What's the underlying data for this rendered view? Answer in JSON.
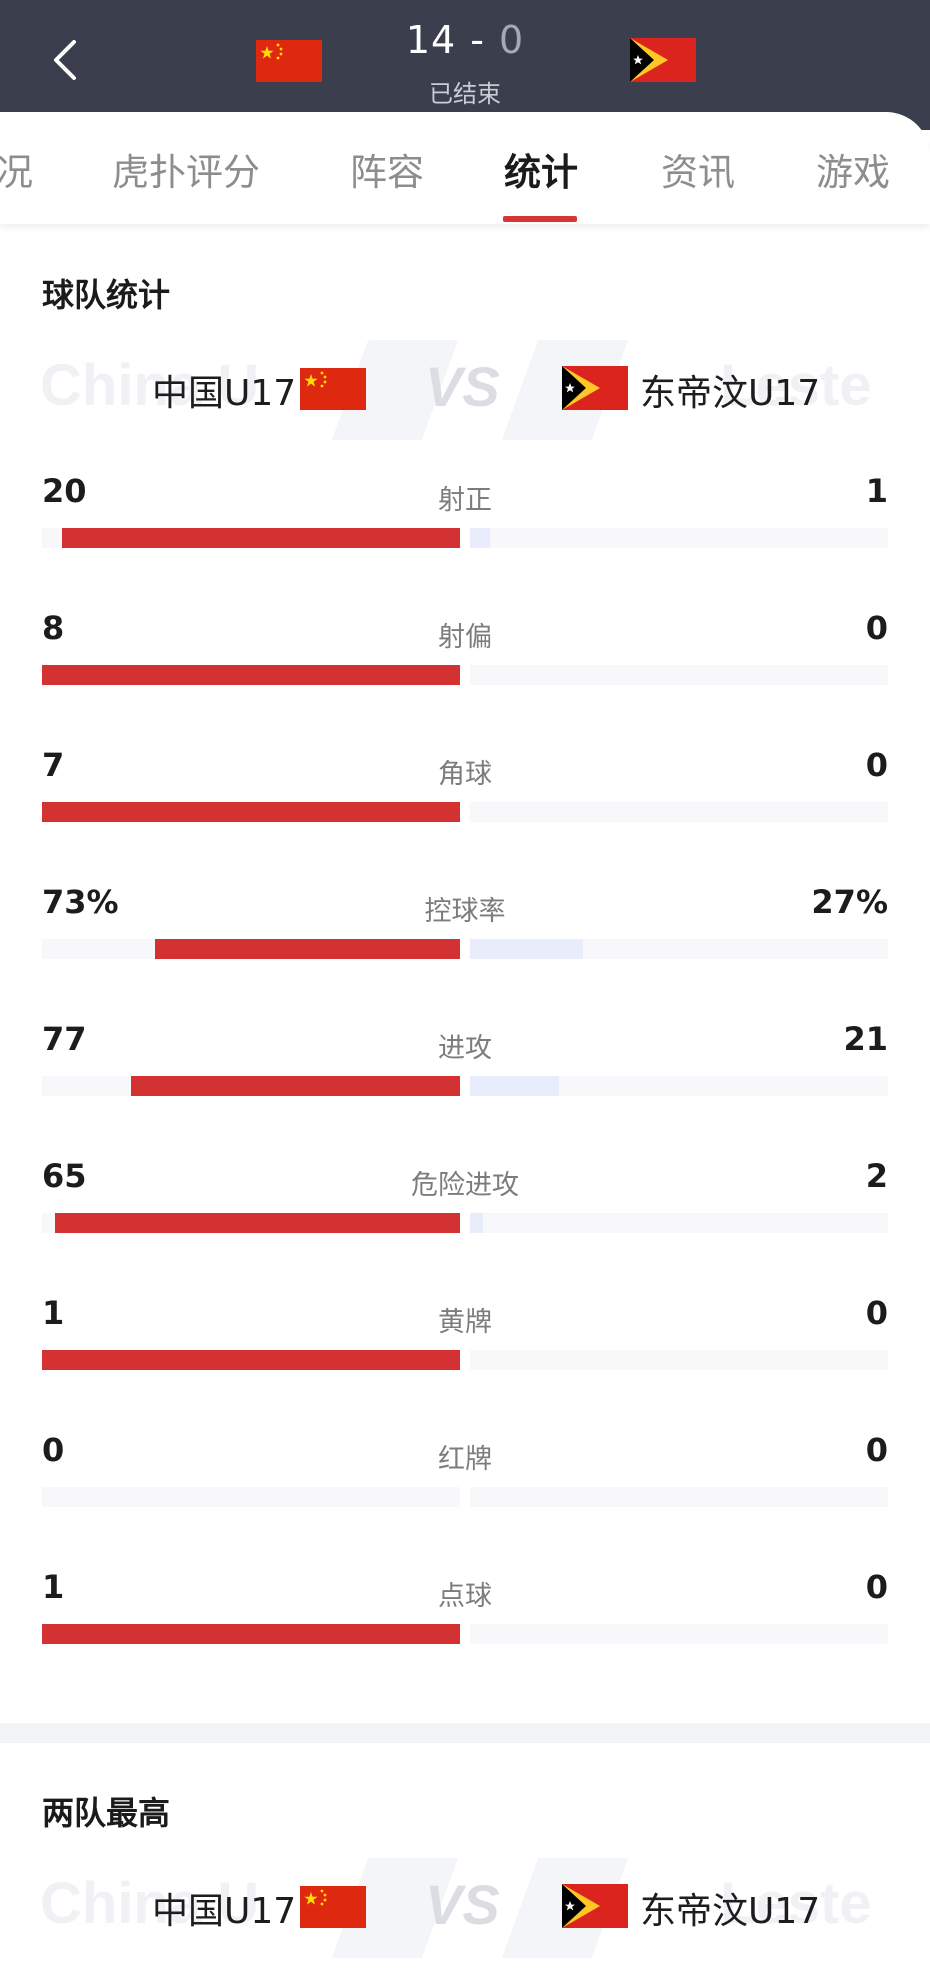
{
  "header": {
    "home_score": "14",
    "separator": "-",
    "away_score": "0",
    "status": "已结束"
  },
  "tabs": [
    {
      "label": "况"
    },
    {
      "label": "虎扑评分"
    },
    {
      "label": "阵容"
    },
    {
      "label": "统计",
      "active": true
    },
    {
      "label": "资讯"
    },
    {
      "label": "游戏"
    }
  ],
  "team_stats": {
    "title": "球队统计",
    "home_team": "中国U17",
    "away_team": "东帝汶U17",
    "home_watermark": "China U",
    "away_watermark": "Leste",
    "vs": "VS",
    "rows": [
      {
        "label": "射正",
        "home": "20",
        "away": "1",
        "home_frac": 0.952,
        "away_frac": 0.048
      },
      {
        "label": "射偏",
        "home": "8",
        "away": "0",
        "home_frac": 1.0,
        "away_frac": 0.0
      },
      {
        "label": "角球",
        "home": "7",
        "away": "0",
        "home_frac": 1.0,
        "away_frac": 0.0
      },
      {
        "label": "控球率",
        "home": "73%",
        "away": "27%",
        "home_frac": 0.73,
        "away_frac": 0.27
      },
      {
        "label": "进攻",
        "home": "77",
        "away": "21",
        "home_frac": 0.786,
        "away_frac": 0.214
      },
      {
        "label": "危险进攻",
        "home": "65",
        "away": "2",
        "home_frac": 0.97,
        "away_frac": 0.03
      },
      {
        "label": "黄牌",
        "home": "1",
        "away": "0",
        "home_frac": 1.0,
        "away_frac": 0.0
      },
      {
        "label": "红牌",
        "home": "0",
        "away": "0",
        "home_frac": 0.0,
        "away_frac": 0.0
      },
      {
        "label": "点球",
        "home": "1",
        "away": "0",
        "home_frac": 1.0,
        "away_frac": 0.0
      }
    ]
  },
  "top_players": {
    "title": "两队最高",
    "home_team": "中国U17",
    "away_team": "东帝汶U17",
    "home_watermark": "China U",
    "away_watermark": "Leste",
    "vs": "VS"
  },
  "colors": {
    "header_bg": "#3b3f4d",
    "home_bar": "#d43232",
    "away_bar": "#e8ecfb",
    "accent": "#d73535"
  }
}
